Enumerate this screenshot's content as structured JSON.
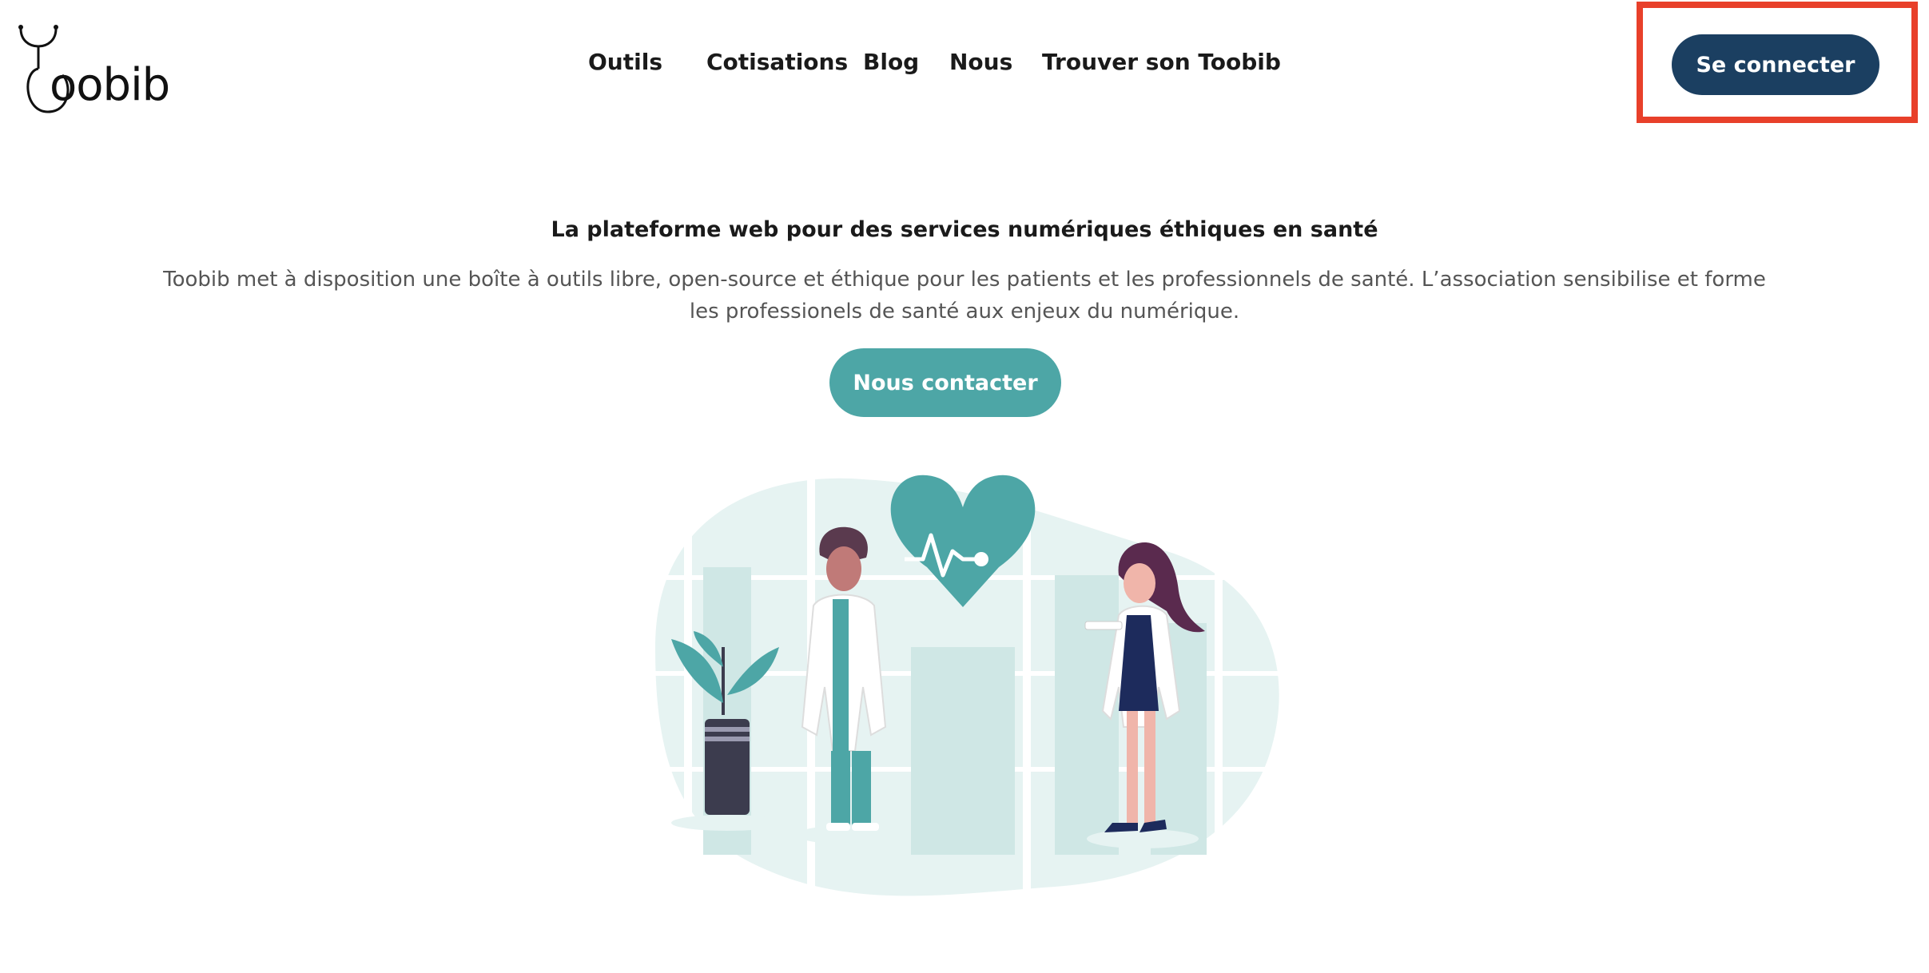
{
  "header": {
    "logo_text": "oobib",
    "nav": [
      {
        "label": "Outils"
      },
      {
        "label": "Cotisations"
      },
      {
        "label": "Blog"
      },
      {
        "label": "Nous"
      },
      {
        "label": "Trouver son Toobib"
      }
    ],
    "login_label": "Se connecter"
  },
  "hero": {
    "title": "La plateforme web pour des services numériques éthiques en santé",
    "description": "Toobib met à disposition une boîte à outils libre, open-source et éthique pour les patients et les professionnels de santé. L’association sensibilise et forme les professionels de santé aux enjeux du numérique.",
    "contact_label": "Nous contacter"
  },
  "colors": {
    "primary": "#1b3f61",
    "accent": "#4da6a6",
    "highlight": "#e8402a"
  }
}
